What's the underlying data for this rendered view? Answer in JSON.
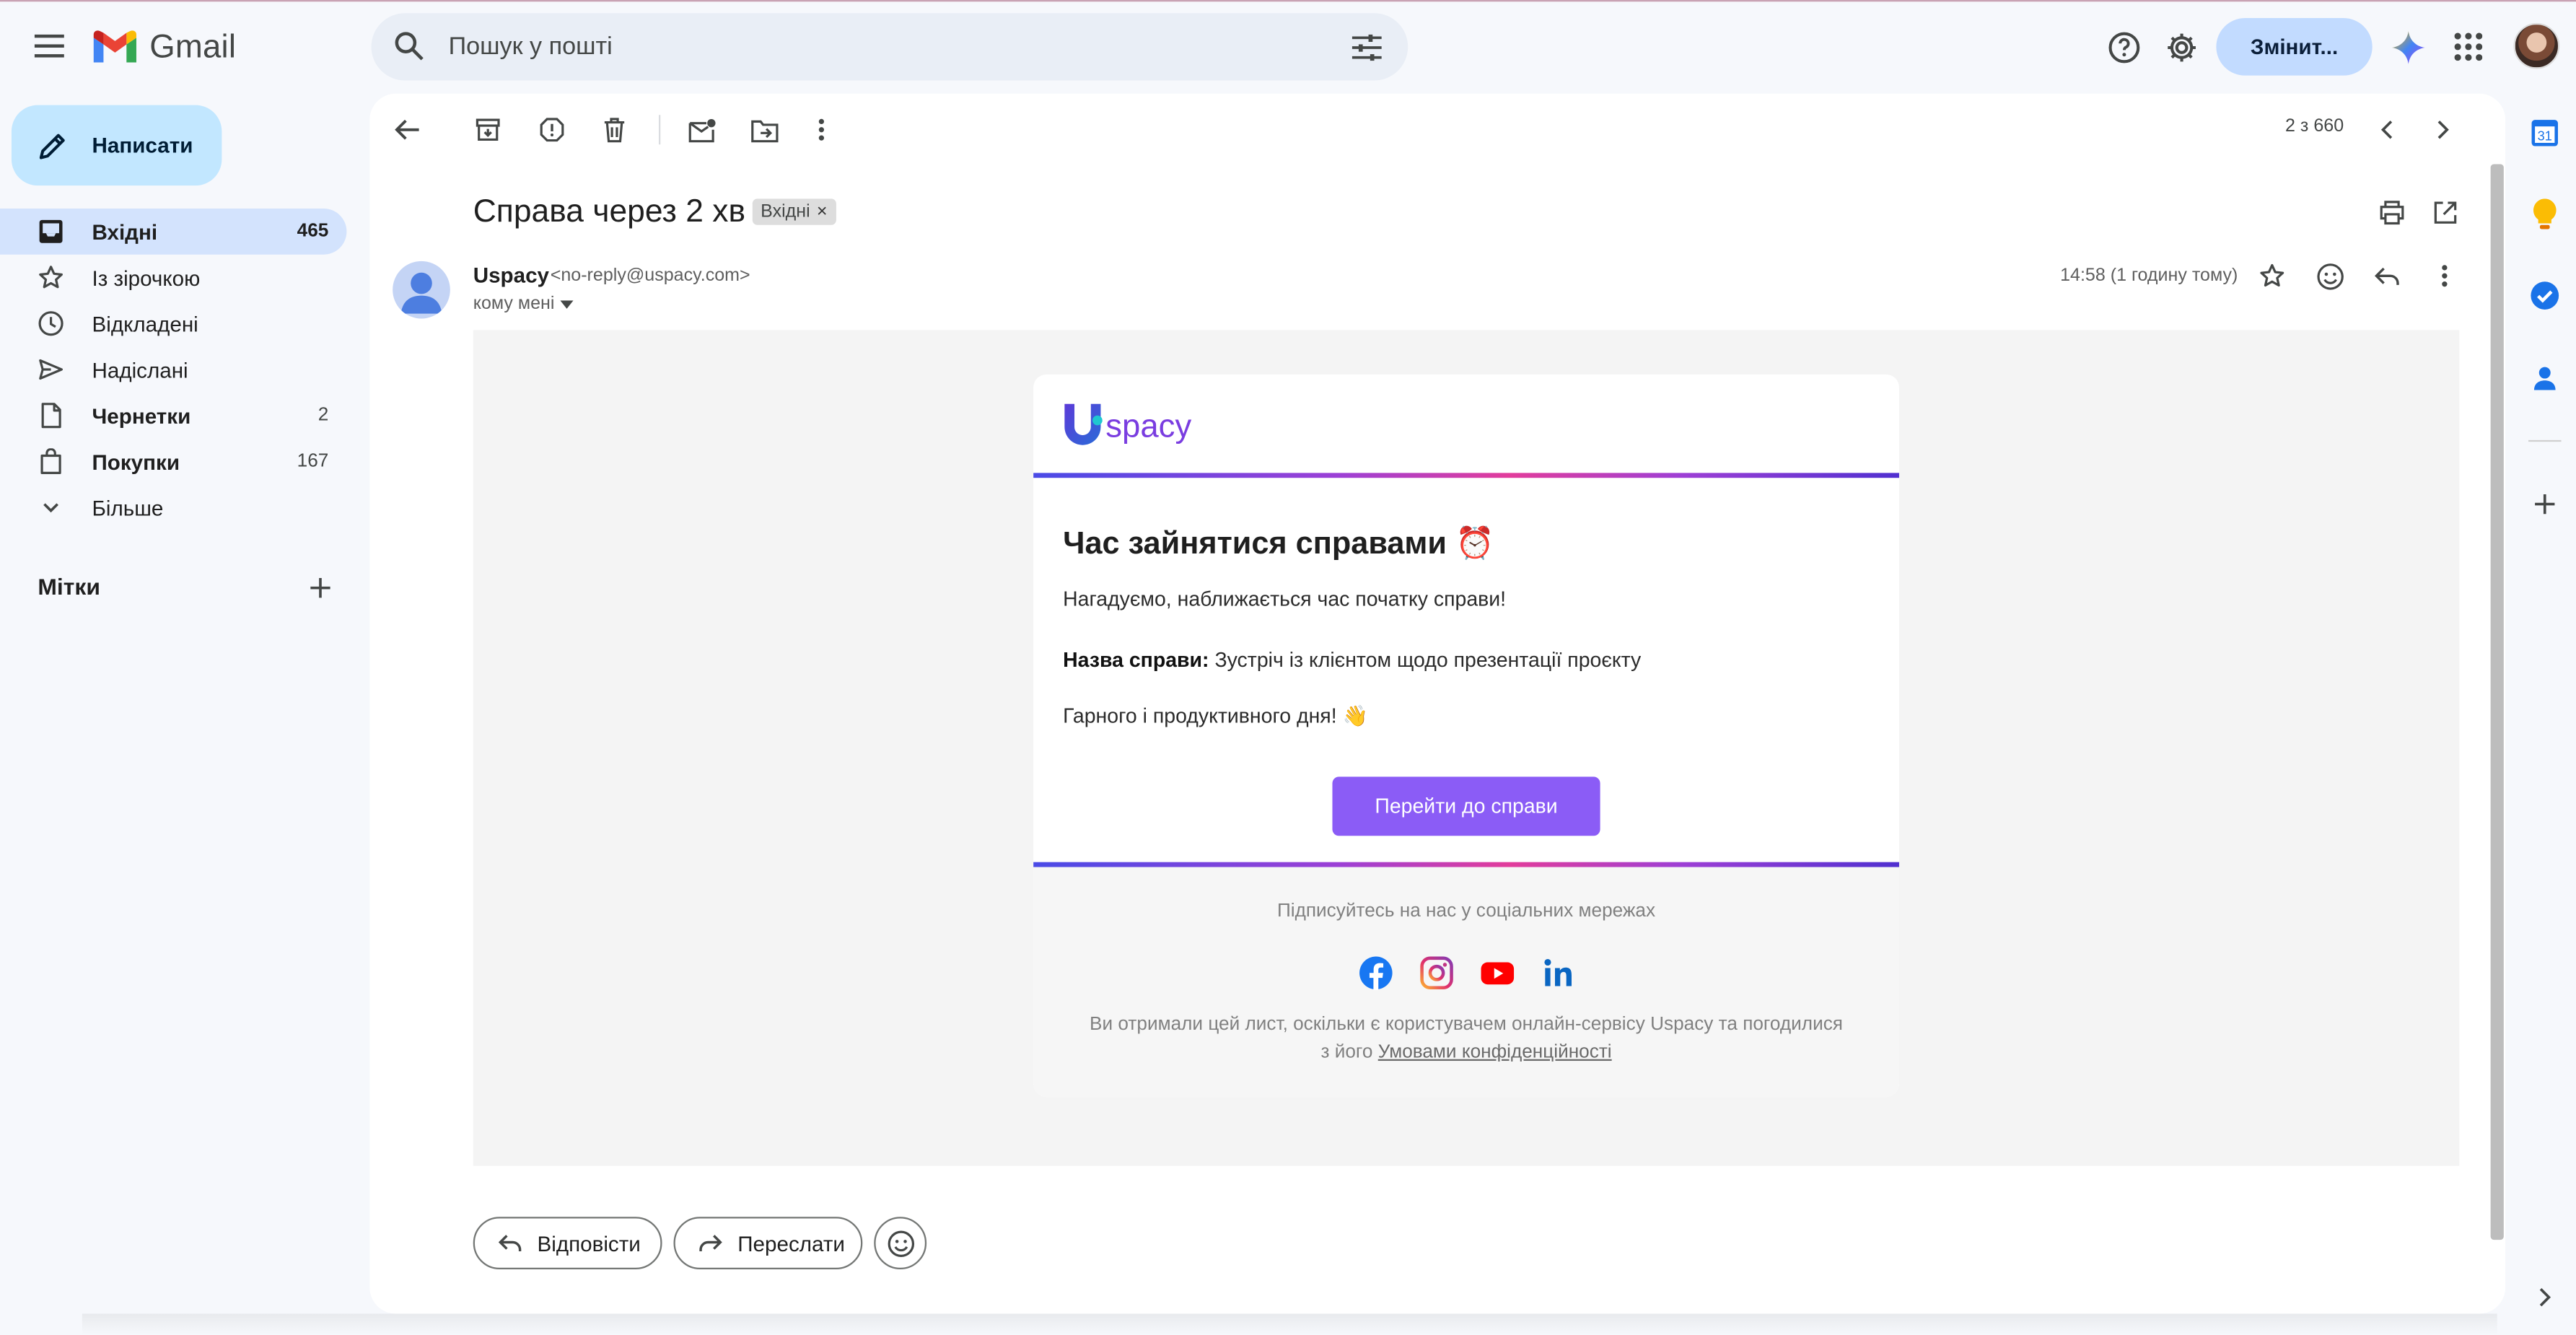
{
  "header": {
    "app_name": "Gmail",
    "search_placeholder": "Пошук у пошті",
    "upgrade_label": "Змінит..."
  },
  "compose_label": "Написати",
  "nav": [
    {
      "label": "Вхідні",
      "count": "465",
      "icon": "inbox-icon",
      "active": true,
      "bold": true
    },
    {
      "label": "Із зірочкою",
      "count": "",
      "icon": "star-icon",
      "bold": false
    },
    {
      "label": "Відкладені",
      "count": "",
      "icon": "clock-icon",
      "bold": false
    },
    {
      "label": "Надіслані",
      "count": "",
      "icon": "send-icon",
      "bold": false
    },
    {
      "label": "Чернетки",
      "count": "2",
      "icon": "draft-icon",
      "bold": true
    },
    {
      "label": "Покупки",
      "count": "167",
      "icon": "shopping-icon",
      "bold": true
    },
    {
      "label": "Більше",
      "count": "",
      "icon": "chevron-down-icon",
      "bold": false
    }
  ],
  "labels_heading": "Мітки",
  "pager": "2 з 660",
  "message": {
    "subject": "Справа через 2 хв",
    "label_chip": "Вхідні",
    "sender_name": "Uspacy",
    "sender_email": "<no-reply@uspacy.com>",
    "to": "кому мені",
    "time": "14:58 (1 годину тому)"
  },
  "email": {
    "brand": "spacy",
    "heading": "Час зайнятися справами ⏰",
    "reminder": "Нагадуємо, наближається час початку справи!",
    "task_label": "Назва справи:",
    "task_name": " Зустріч із клієнтом щодо презентації проєкту",
    "wish": "Гарного і продуктивного дня! 👋",
    "button": "Перейти до справи",
    "social_title": "Підписуйтесь на нас у соціальних мережах",
    "legal_line1": "Ви отримали цей лист, оскільки є користувачем онлайн-сервісу Uspacy та погодилися",
    "legal_prefix": "з його ",
    "legal_link": "Умовами конфіденційності"
  },
  "actions": {
    "reply": "Відповісти",
    "forward": "Переслати"
  },
  "rail": {
    "calendar_day": "31"
  },
  "colors": {
    "accent": "#8b5cf6",
    "nav_active": "#d3e3fd",
    "compose": "#c2e7ff"
  }
}
